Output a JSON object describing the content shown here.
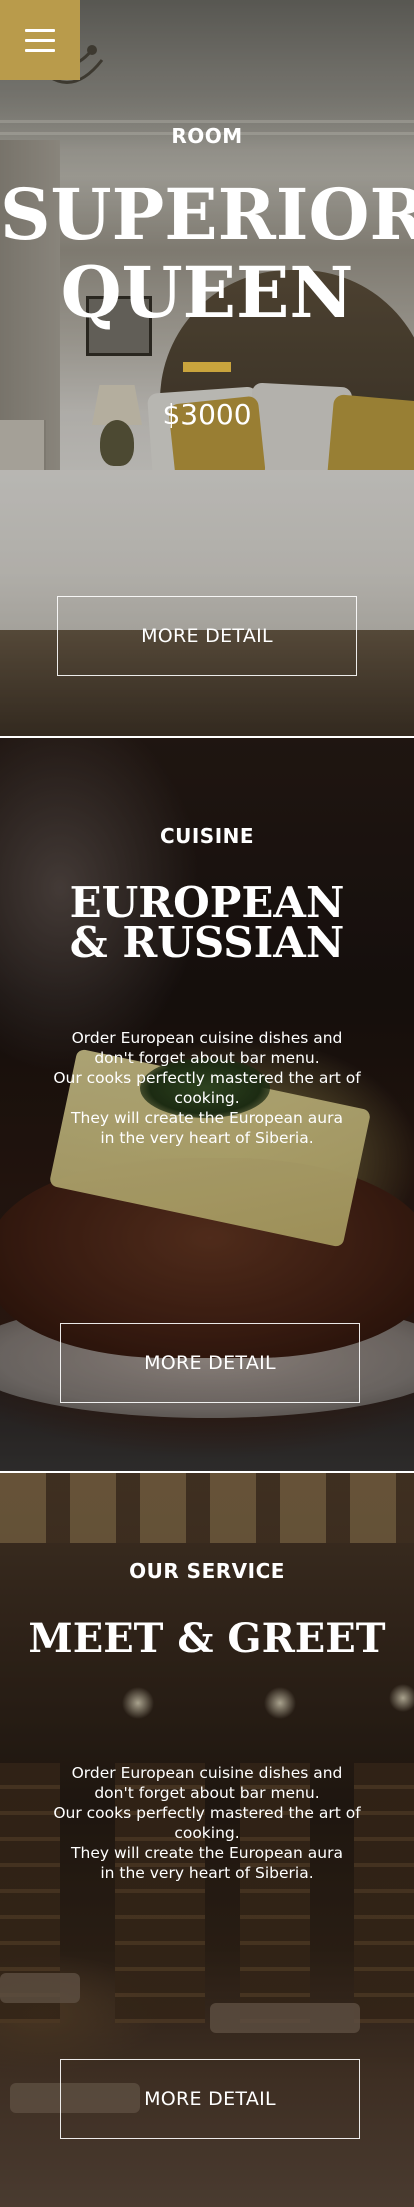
{
  "menu": {
    "icon": "hamburger-icon"
  },
  "sections": [
    {
      "kicker": "ROOM",
      "title_line1": "SUPERIOR",
      "title_line2": "QUEEN",
      "price": "$3000",
      "button": "MORE DETAIL"
    },
    {
      "kicker": "CUISINE",
      "title_line1": "EUROPEAN",
      "title_line2": "& RUSSIAN",
      "description": [
        "Order European cuisine dishes and",
        "don't forget about bar menu.",
        "Our cooks perfectly mastered the art of cooking.",
        "They will create the European aura",
        "in the very heart of Siberia."
      ],
      "button": "MORE DETAIL"
    },
    {
      "kicker": "OUR SERVICE",
      "title_line1": "MEET & GREET",
      "description": [
        "Order European cuisine dishes and",
        "don't forget about bar menu.",
        "Our cooks perfectly mastered the art of cooking.",
        "They will create the European aura",
        "in the very heart of Siberia."
      ],
      "button": "MORE DETAIL"
    }
  ],
  "colors": {
    "accent": "#c9a43d",
    "menu_bg": "#b99b4b",
    "text": "#ffffff"
  }
}
